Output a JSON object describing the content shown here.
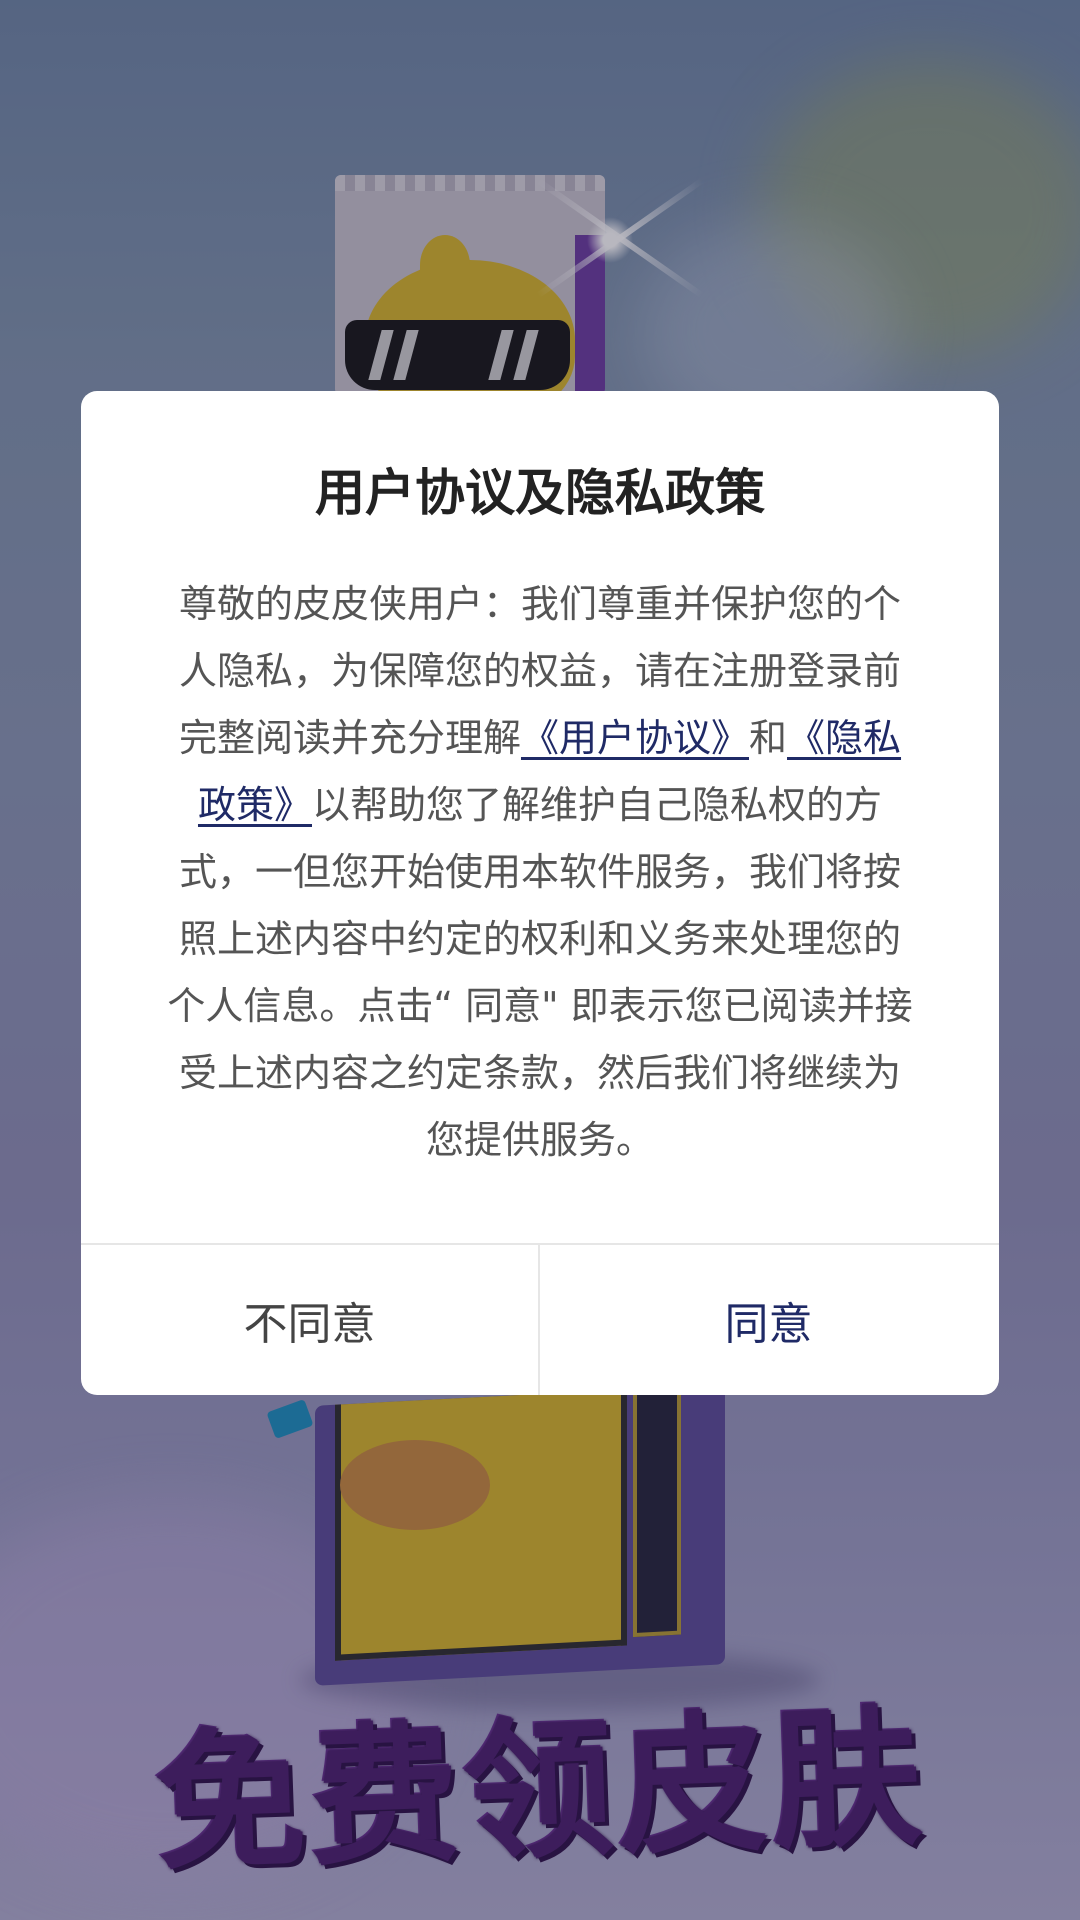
{
  "background": {
    "promo_title": "免费领皮肤"
  },
  "dialog": {
    "title": "用户协议及隐私政策",
    "body_part1": "尊敬的皮皮侠用户：我们尊重并保护您的个人隐私，为保障您的权益，请在注册登录前完整阅读并充分理解",
    "user_agreement_link": "《用户协议》",
    "and_text": "和",
    "privacy_policy_link": "《隐私政策》",
    "body_part2": "以帮助您了解维护自己隐私权的方式，一但您开始使用本软件服务，我们将按照上述内容中约定的权利和义务来处理您的个人信息。点击“ 同意\" 即表示您已阅读并接受上述内容之约定条款，然后我们将继续为您提供服务。",
    "disagree_label": "不同意",
    "agree_label": "同意"
  },
  "colors": {
    "link": "#1f2a66",
    "agree_text": "#1f2a66",
    "dialog_bg": "#ffffff",
    "promo_text": "#4a1c6e"
  }
}
